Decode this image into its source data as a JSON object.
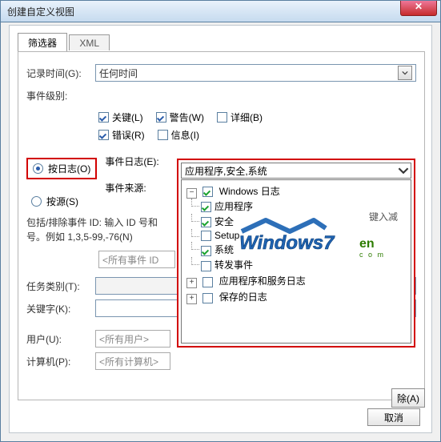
{
  "window": {
    "title": "创建自定义视图"
  },
  "tabs": {
    "filter": "筛选器",
    "xml": "XML"
  },
  "labels": {
    "log_time": "记录时间(G):",
    "event_level": "事件级别:",
    "by_log": "按日志(O)",
    "by_source": "按源(S)",
    "event_logs": "事件日志(E):",
    "event_sources": "事件来源:",
    "include_exclude": "包括/排除事件 ID: 输入 ID 号和",
    "include_exclude2": "号。例如 1,3,5-99,-76(N)",
    "task_category": "任务类别(T):",
    "keywords": "关键字(K):",
    "user": "用户(U):",
    "computer": "计算机(P):"
  },
  "fields": {
    "log_time_value": "任何时间",
    "task_category_value": "",
    "keywords_value": "",
    "all_event_id": "<所有事件 ID",
    "all_users": "<所有用户>",
    "all_computers": "<所有计算机>"
  },
  "levels": {
    "critical": "关键(L)",
    "warning": "警告(W)",
    "verbose": "详细(B)",
    "error": "错误(R)",
    "information": "信息(I)"
  },
  "dropdown": {
    "selected": "应用程序,安全,系统",
    "root": "Windows 日志",
    "nodes": [
      "应用程序",
      "安全",
      "Setup",
      "系统",
      "转发事件"
    ],
    "apps_services": "应用程序和服务日志",
    "saved": "保存的日志",
    "checked": [
      true,
      true,
      false,
      true,
      false
    ]
  },
  "buttons": {
    "cancel_bottom": "取消",
    "clear": "除(A)"
  },
  "watermark": {
    "top": "键入减",
    "brand1": "Windows7",
    "brand2": "en",
    "brand3": "c o m"
  }
}
